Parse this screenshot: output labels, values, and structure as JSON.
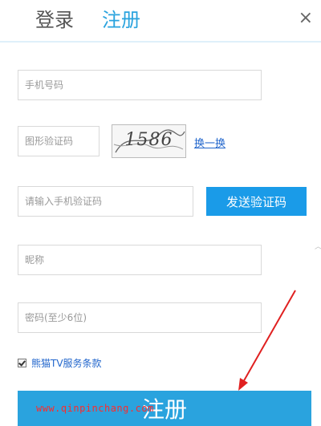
{
  "header": {
    "tab_login": "登录",
    "tab_register": "注册",
    "close_label": "×"
  },
  "form": {
    "phone_placeholder": "手机号码",
    "captcha_placeholder": "图形验证码",
    "captcha_image_text": "1586",
    "refresh_label": "换一换",
    "sms_code_placeholder": "请输入手机验证码",
    "send_code_label": "发送验证码",
    "nickname_placeholder": "昵称",
    "password_placeholder": "密码(至少6位)",
    "terms_label": "熊猫TV服务条款",
    "terms_checked": true,
    "submit_label": "注册"
  },
  "watermark": "www.qinpinchang.com",
  "colors": {
    "accent": "#2aa3de",
    "send_button": "#1a9be8",
    "link": "#2266cc",
    "annotation_arrow": "#e02020"
  },
  "icons": {
    "close": "close-icon",
    "checkbox": "checkmark-icon",
    "annotation": "red-arrow-icon"
  }
}
